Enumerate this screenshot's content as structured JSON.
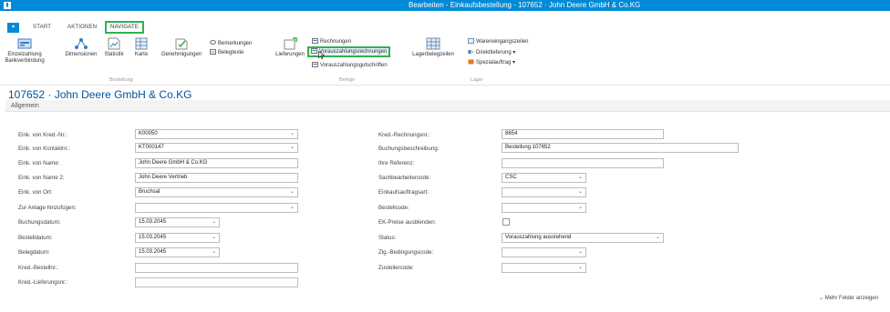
{
  "window": {
    "title": "Bearbeiten - Einkaufsbestellung - 107652 · John Deere GmbH & Co.KG"
  },
  "tabs": [
    "START",
    "AKTIONEN",
    "NAVIGATE"
  ],
  "ribbon": {
    "bestellung": {
      "items": [
        "Einzelzahlung Bankverbindung",
        "Dimensionen",
        "Statistik",
        "Karte",
        "Genehmigungen"
      ],
      "bemerkungen": "Bemerkungen",
      "belegtexte": "Belegtexte",
      "group_label": "Bestellung"
    },
    "belege": {
      "lieferungen": "Lieferungen",
      "rechnungen": "Rechnungen",
      "vorauszahlungsrechnungen": "Vorauszahlungsrechnungen",
      "vorauszahlungsgutschriften": "Vorauszahlungsgutschriften",
      "group_label": "Belege"
    },
    "lager": {
      "lagerbelegzeilen": "Lagerbelegzeilen",
      "wareneingangszeilen": "Wareneingangszeilen",
      "direktlieferung": "Direktlieferung",
      "spezialauftrag": "Spezialauftrag",
      "group_label": "Lager"
    }
  },
  "page": {
    "title": "107652 · John Deere GmbH & Co.KG",
    "section": "Allgemein"
  },
  "form_left": {
    "eink_kred_nr": {
      "label": "Eink. von Kred.-Nr.:",
      "value": "K00050"
    },
    "eink_kontaktnr": {
      "label": "Eink. von Kontaktnr.:",
      "value": "KT000147"
    },
    "eink_name": {
      "label": "Eink. von Name:",
      "value": "John Deere GmbH & Co.KG"
    },
    "eink_name2": {
      "label": "Eink. von Name 2:",
      "value": "John Deere Vertrieb"
    },
    "eink_ort": {
      "label": "Eink. von Ort:",
      "value": "Bruchsal"
    },
    "zur_anlage": {
      "label": "Zur Anlage hinzufügen:",
      "value": ""
    },
    "buchungsdatum": {
      "label": "Buchungsdatum:",
      "value": "15.03.2045"
    },
    "bestelldatum": {
      "label": "Bestelldatum:",
      "value": "15.03.2045"
    },
    "belegdatum": {
      "label": "Belegdatum:",
      "value": "15.03.2045"
    },
    "kred_bestellnr": {
      "label": "Kred.-Bestellnr.:",
      "value": ""
    },
    "kred_lieferungsnr": {
      "label": "Kred.-Lieferungsnr.:",
      "value": ""
    }
  },
  "form_right": {
    "kred_rechnungsnr": {
      "label": "Kred.-Rechnungsnr.:",
      "value": "8654"
    },
    "buchungsbeschreibung": {
      "label": "Buchungsbeschreibung:",
      "value": "Bestellung 107652"
    },
    "ihre_referenz": {
      "label": "Ihre Referenz:",
      "value": ""
    },
    "sachbearbeitercode": {
      "label": "Sachbearbeitercode:",
      "value": "CSC"
    },
    "einkaufsauftragsart": {
      "label": "Einkaufsauftragsart:",
      "value": ""
    },
    "bestellcode": {
      "label": "Bestellcode:",
      "value": ""
    },
    "ek_preise": {
      "label": "EK-Preise ausblenden:"
    },
    "status": {
      "label": "Status:",
      "value": "Vorauszahlung ausstehend"
    },
    "zlg_bedingungscode": {
      "label": "Zlg.-Bedingungscode:",
      "value": ""
    },
    "zustellercode": {
      "label": "Zustellercode:",
      "value": ""
    }
  },
  "more_fields": "Mehr Felder anzeigen",
  "colors": {
    "accent": "#008ad7",
    "highlight": "#2fb34a",
    "title": "#00539f"
  },
  "icons": [
    "app-icon",
    "file-menu-icon",
    "bank-icon",
    "dimensions-icon",
    "statistics-icon",
    "card-icon",
    "approvals-icon",
    "comments-icon",
    "document-text-icon",
    "deliveries-icon",
    "invoices-icon",
    "prepayment-invoice-icon",
    "prepayment-credit-icon",
    "warehouse-lines-icon",
    "receipt-lines-icon",
    "drop-shipment-icon",
    "special-order-icon",
    "chevron-down-icon",
    "mouse-cursor-icon"
  ]
}
